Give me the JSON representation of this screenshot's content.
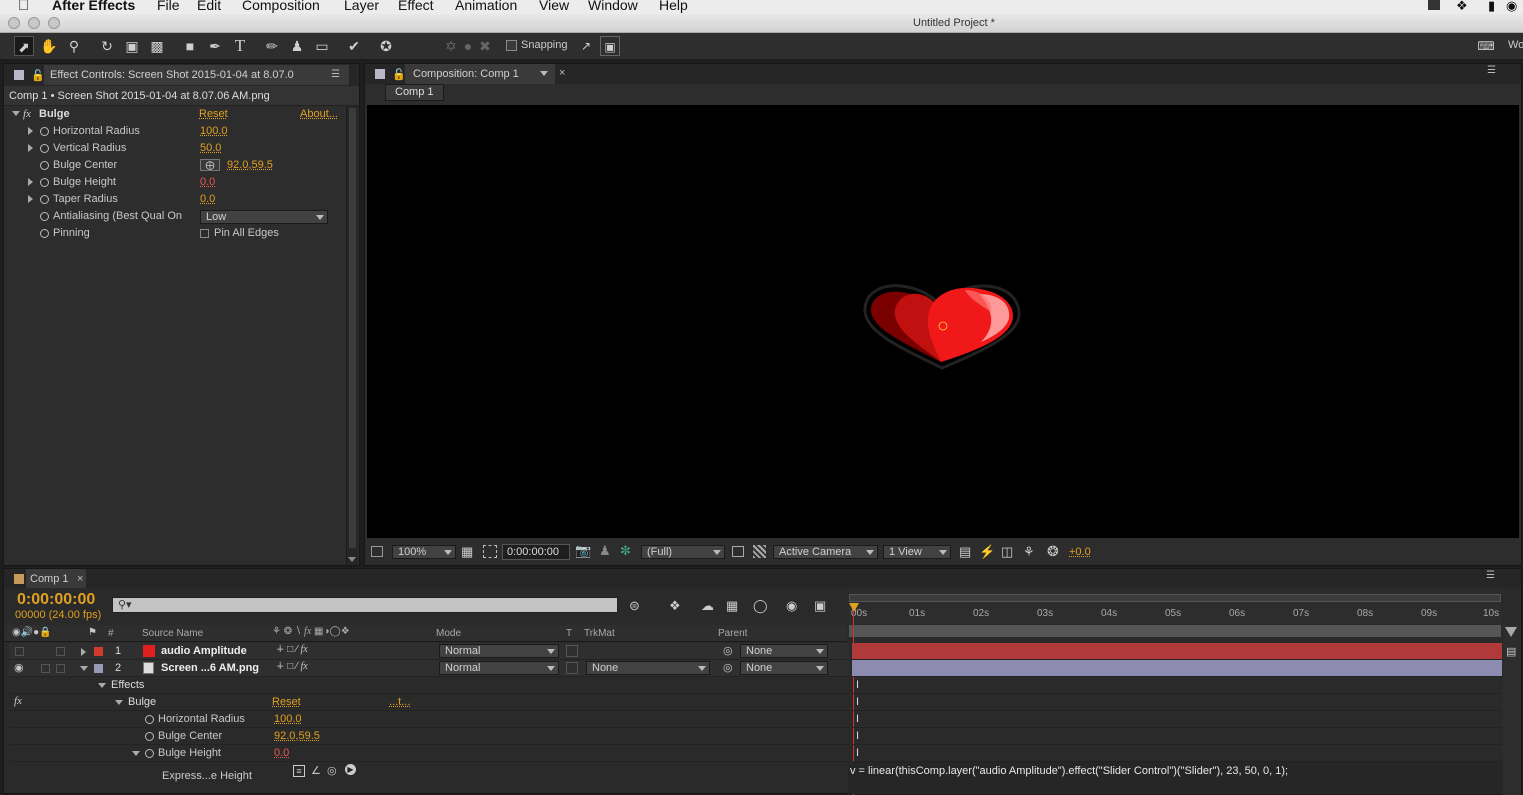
{
  "menubar": {
    "app": "After Effects",
    "items": [
      "File",
      "Edit",
      "Composition",
      "Layer",
      "Effect",
      "Animation",
      "View",
      "Window",
      "Help"
    ],
    "right_label": "Wo"
  },
  "window": {
    "title": "Untitled Project *"
  },
  "toolbar": {
    "snapping_label": "Snapping"
  },
  "effect_controls": {
    "tab": "Effect Controls: Screen Shot 2015-01-04 at 8.07.0",
    "subtitle": "Comp 1 • Screen Shot 2015-01-04 at 8.07.06 AM.png",
    "effect": {
      "fx": "fx",
      "name": "Bulge",
      "reset": "Reset",
      "about": "About..."
    },
    "props": [
      {
        "name": "Horizontal Radius",
        "value": "100.0"
      },
      {
        "name": "Vertical Radius",
        "value": "50.0"
      },
      {
        "name": "Bulge Center",
        "value": "92.0,59.5"
      },
      {
        "name": "Bulge Height",
        "value": "0.0"
      },
      {
        "name": "Taper Radius",
        "value": "0.0"
      },
      {
        "name": "Antialiasing (Best Qual On",
        "value": "Low"
      },
      {
        "name": "Pinning",
        "value": "Pin All Edges"
      }
    ]
  },
  "composition": {
    "tab": "Composition: Comp 1",
    "subtab": "Comp 1",
    "footer": {
      "zoom": "100%",
      "timecode": "0:00:00:00",
      "resolution": "(Full)",
      "camera": "Active Camera",
      "views": "1 View",
      "exposure": "+0.0"
    }
  },
  "timeline": {
    "tab": "Comp 1",
    "timecode": "0:00:00:00",
    "frames": "00000 (24.00 fps)",
    "search_placeholder": "",
    "columns": {
      "hash": "#",
      "source": "Source Name",
      "mode": "Mode",
      "t": "T",
      "trkmat": "TrkMat",
      "parent": "Parent"
    },
    "ruler": [
      "00s",
      "01s",
      "02s",
      "03s",
      "04s",
      "05s",
      "06s",
      "07s",
      "08s",
      "09s",
      "10s"
    ],
    "layers": [
      {
        "num": "1",
        "name": "audio Amplitude",
        "mode": "Normal",
        "trkmat": "",
        "parent": "None",
        "color": "#d23a2a"
      },
      {
        "num": "2",
        "name": "Screen ...6 AM.png",
        "mode": "Normal",
        "trkmat": "None",
        "parent": "None",
        "color": "#9a9ab8"
      }
    ],
    "effects_label": "Effects",
    "fx": "fx",
    "bulge": {
      "name": "Bulge",
      "reset": "Reset",
      "dots": "...t..."
    },
    "props": [
      {
        "name": "Horizontal Radius",
        "value": "100.0"
      },
      {
        "name": "Bulge Center",
        "value": "92.0,59.5"
      },
      {
        "name": "Bulge Height",
        "value": "0.0"
      }
    ],
    "expression_label": "Express...e Height",
    "expression": "v = linear(thisComp.layer(\"audio Amplitude\").effect(\"Slider Control\")(\"Slider\"), 23, 50, 0, 1);"
  },
  "colors": {
    "accent": "#e0a020",
    "track_red": "#b03a3a",
    "track_lilac": "#8d8cb0"
  }
}
